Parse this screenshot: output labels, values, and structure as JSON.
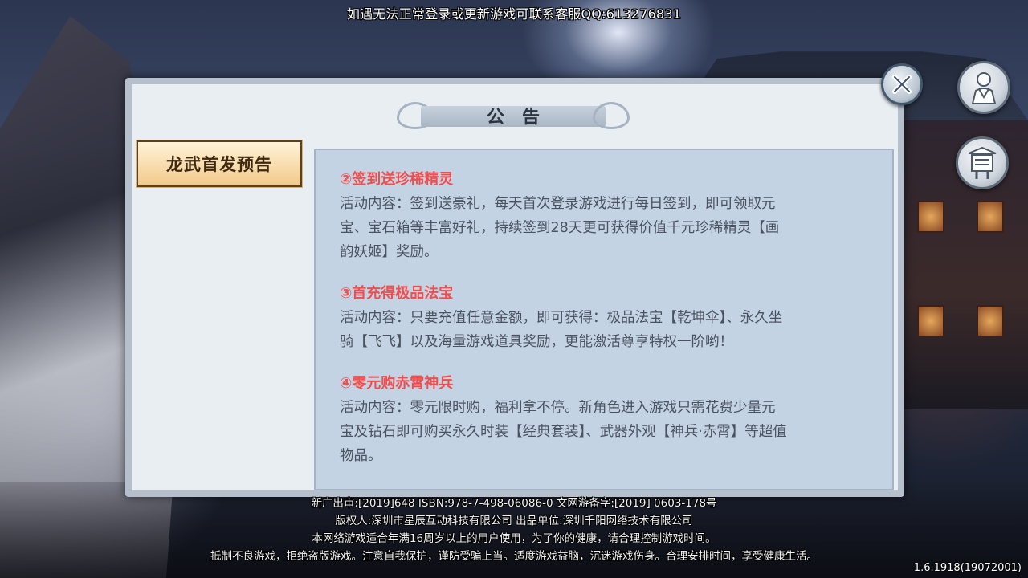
{
  "top_notice": "如遇无法正常登录或更新游戏可联系客服QQ:613276831",
  "panel": {
    "title": "公告",
    "tabs": [
      {
        "label": "龙武首发预告",
        "selected": true
      }
    ],
    "sections": [
      {
        "title": "②签到送珍稀精灵",
        "lines": [
          "活动内容：签到送豪礼，每天首次登录游戏进行每日签到，即可领取元",
          "宝、宝石箱等丰富好礼，持续签到28天更可获得价值千元珍稀精灵【画",
          "韵妖姬】奖励。"
        ]
      },
      {
        "title": "③首充得极品法宝",
        "lines": [
          "活动内容：只要充值任意金额，即可获得：极品法宝【乾坤伞】、永久坐",
          "骑【飞飞】以及海量游戏道具奖励，更能激活尊享特权一阶哟！"
        ]
      },
      {
        "title": "④零元购赤霄神兵",
        "lines": [
          "活动内容：零元限时购，福利拿不停。新角色进入游戏只需花费少量元",
          "宝及钻石即可购买永久时装【经典套装】、武器外观【神兵·赤霄】等超值",
          "物品。"
        ]
      }
    ]
  },
  "side_buttons": {
    "character_icon": "person-icon",
    "notice_board_icon": "notice-board-icon",
    "close_icon": "close-icon"
  },
  "footer": {
    "line1": "新广出审:[2019]648  ISBN:978-7-498-06086-0  文网游备字:[2019]  0603-178号",
    "line2": "版权人:深圳市星辰互动科技有限公司  出品单位:深圳千阳网络技术有限公司",
    "line3": "本网络游戏适合年满16周岁以上的用户使用，为了你的健康，请合理控制游戏时间。",
    "line4": "抵制不良游戏，拒绝盗版游戏。注意自我保护，谨防受骗上当。适度游戏益脑，沉迷游戏伤身。合理安排时间，享受健康生活。"
  },
  "version": "1.6.1918(19072001)",
  "colors": {
    "section_title": "#f04d4d",
    "body_text": "#4a5260",
    "content_bg": "#c4d3e3",
    "tab_bg": "#f2c98a"
  }
}
